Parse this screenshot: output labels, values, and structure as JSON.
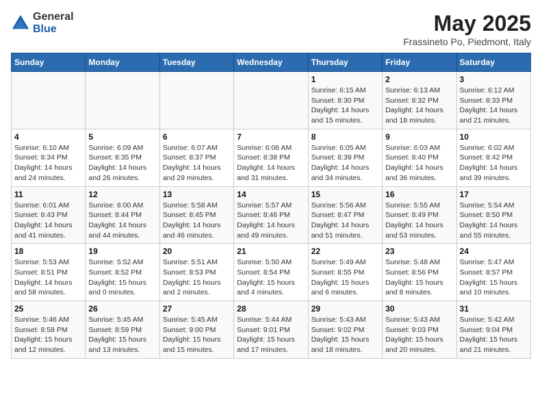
{
  "logo": {
    "general": "General",
    "blue": "Blue"
  },
  "title": "May 2025",
  "subtitle": "Frassineto Po, Piedmont, Italy",
  "days_of_week": [
    "Sunday",
    "Monday",
    "Tuesday",
    "Wednesday",
    "Thursday",
    "Friday",
    "Saturday"
  ],
  "weeks": [
    [
      {
        "day": "",
        "info": ""
      },
      {
        "day": "",
        "info": ""
      },
      {
        "day": "",
        "info": ""
      },
      {
        "day": "",
        "info": ""
      },
      {
        "day": "1",
        "info": "Sunrise: 6:15 AM\nSunset: 8:30 PM\nDaylight: 14 hours\nand 15 minutes."
      },
      {
        "day": "2",
        "info": "Sunrise: 6:13 AM\nSunset: 8:32 PM\nDaylight: 14 hours\nand 18 minutes."
      },
      {
        "day": "3",
        "info": "Sunrise: 6:12 AM\nSunset: 8:33 PM\nDaylight: 14 hours\nand 21 minutes."
      }
    ],
    [
      {
        "day": "4",
        "info": "Sunrise: 6:10 AM\nSunset: 8:34 PM\nDaylight: 14 hours\nand 24 minutes."
      },
      {
        "day": "5",
        "info": "Sunrise: 6:09 AM\nSunset: 8:35 PM\nDaylight: 14 hours\nand 26 minutes."
      },
      {
        "day": "6",
        "info": "Sunrise: 6:07 AM\nSunset: 8:37 PM\nDaylight: 14 hours\nand 29 minutes."
      },
      {
        "day": "7",
        "info": "Sunrise: 6:06 AM\nSunset: 8:38 PM\nDaylight: 14 hours\nand 31 minutes."
      },
      {
        "day": "8",
        "info": "Sunrise: 6:05 AM\nSunset: 8:39 PM\nDaylight: 14 hours\nand 34 minutes."
      },
      {
        "day": "9",
        "info": "Sunrise: 6:03 AM\nSunset: 8:40 PM\nDaylight: 14 hours\nand 36 minutes."
      },
      {
        "day": "10",
        "info": "Sunrise: 6:02 AM\nSunset: 8:42 PM\nDaylight: 14 hours\nand 39 minutes."
      }
    ],
    [
      {
        "day": "11",
        "info": "Sunrise: 6:01 AM\nSunset: 8:43 PM\nDaylight: 14 hours\nand 41 minutes."
      },
      {
        "day": "12",
        "info": "Sunrise: 6:00 AM\nSunset: 8:44 PM\nDaylight: 14 hours\nand 44 minutes."
      },
      {
        "day": "13",
        "info": "Sunrise: 5:58 AM\nSunset: 8:45 PM\nDaylight: 14 hours\nand 46 minutes."
      },
      {
        "day": "14",
        "info": "Sunrise: 5:57 AM\nSunset: 8:46 PM\nDaylight: 14 hours\nand 49 minutes."
      },
      {
        "day": "15",
        "info": "Sunrise: 5:56 AM\nSunset: 8:47 PM\nDaylight: 14 hours\nand 51 minutes."
      },
      {
        "day": "16",
        "info": "Sunrise: 5:55 AM\nSunset: 8:49 PM\nDaylight: 14 hours\nand 53 minutes."
      },
      {
        "day": "17",
        "info": "Sunrise: 5:54 AM\nSunset: 8:50 PM\nDaylight: 14 hours\nand 55 minutes."
      }
    ],
    [
      {
        "day": "18",
        "info": "Sunrise: 5:53 AM\nSunset: 8:51 PM\nDaylight: 14 hours\nand 58 minutes."
      },
      {
        "day": "19",
        "info": "Sunrise: 5:52 AM\nSunset: 8:52 PM\nDaylight: 15 hours\nand 0 minutes."
      },
      {
        "day": "20",
        "info": "Sunrise: 5:51 AM\nSunset: 8:53 PM\nDaylight: 15 hours\nand 2 minutes."
      },
      {
        "day": "21",
        "info": "Sunrise: 5:50 AM\nSunset: 8:54 PM\nDaylight: 15 hours\nand 4 minutes."
      },
      {
        "day": "22",
        "info": "Sunrise: 5:49 AM\nSunset: 8:55 PM\nDaylight: 15 hours\nand 6 minutes."
      },
      {
        "day": "23",
        "info": "Sunrise: 5:48 AM\nSunset: 8:56 PM\nDaylight: 15 hours\nand 8 minutes."
      },
      {
        "day": "24",
        "info": "Sunrise: 5:47 AM\nSunset: 8:57 PM\nDaylight: 15 hours\nand 10 minutes."
      }
    ],
    [
      {
        "day": "25",
        "info": "Sunrise: 5:46 AM\nSunset: 8:58 PM\nDaylight: 15 hours\nand 12 minutes."
      },
      {
        "day": "26",
        "info": "Sunrise: 5:45 AM\nSunset: 8:59 PM\nDaylight: 15 hours\nand 13 minutes."
      },
      {
        "day": "27",
        "info": "Sunrise: 5:45 AM\nSunset: 9:00 PM\nDaylight: 15 hours\nand 15 minutes."
      },
      {
        "day": "28",
        "info": "Sunrise: 5:44 AM\nSunset: 9:01 PM\nDaylight: 15 hours\nand 17 minutes."
      },
      {
        "day": "29",
        "info": "Sunrise: 5:43 AM\nSunset: 9:02 PM\nDaylight: 15 hours\nand 18 minutes."
      },
      {
        "day": "30",
        "info": "Sunrise: 5:43 AM\nSunset: 9:03 PM\nDaylight: 15 hours\nand 20 minutes."
      },
      {
        "day": "31",
        "info": "Sunrise: 5:42 AM\nSunset: 9:04 PM\nDaylight: 15 hours\nand 21 minutes."
      }
    ]
  ]
}
